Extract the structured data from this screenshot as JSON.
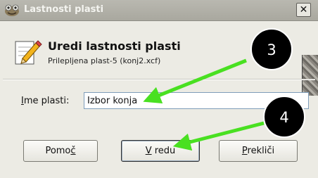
{
  "window": {
    "title": "Lastnosti plasti",
    "close_label": "✕"
  },
  "header": {
    "title": "Uredi lastnosti plasti",
    "subtitle": "Prilepljena plast-5 (konj2.xcf)"
  },
  "form": {
    "name_label_mnemonic": "I",
    "name_label_rest": "me plasti:",
    "name_value": "Izbor konja"
  },
  "buttons": {
    "help_prefix": "Pomo",
    "help_mnemonic": "č",
    "ok_mnemonic": "V",
    "ok_rest": " redu",
    "cancel_mnemonic": "P",
    "cancel_rest": "rekliči"
  },
  "annotations": [
    {
      "number": "3"
    },
    {
      "number": "4"
    }
  ],
  "colors": {
    "arrow": "#49e021",
    "badge": "#000000"
  }
}
